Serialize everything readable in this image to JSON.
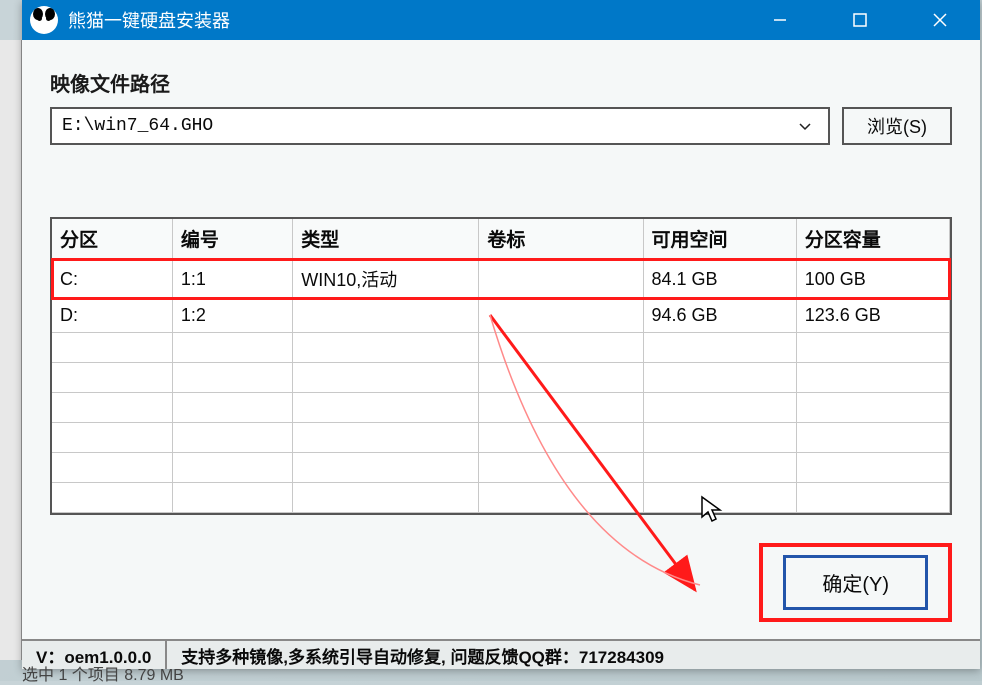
{
  "window": {
    "title": "熊猫一键硬盘安装器"
  },
  "path": {
    "label": "映像文件路径",
    "value": "E:\\win7_64.GHO",
    "browse_label": "浏览(S)"
  },
  "table": {
    "headers": {
      "partition": "分区",
      "number": "编号",
      "type": "类型",
      "label": "卷标",
      "free": "可用空间",
      "capacity": "分区容量"
    },
    "rows": [
      {
        "partition": "C:",
        "number": "1:1",
        "type": "WIN10,活动",
        "label": "",
        "free": "84.1 GB",
        "capacity": "100 GB",
        "highlight": true
      },
      {
        "partition": "D:",
        "number": "1:2",
        "type": "",
        "label": "",
        "free": "94.6 GB",
        "capacity": "123.6 GB",
        "highlight": false
      }
    ]
  },
  "actions": {
    "confirm_label": "确定(Y)"
  },
  "statusbar": {
    "version": "V：oem1.0.0.0",
    "info": "支持多种镜像,多系统引导自动修复, 问题反馈QQ群：717284309"
  },
  "background_crop": "选中 1 个项目  8.79 MB"
}
